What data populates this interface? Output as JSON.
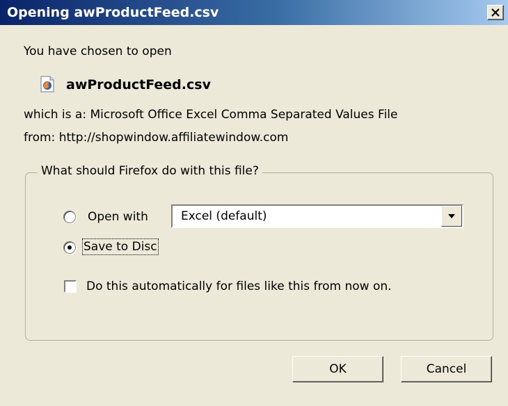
{
  "window": {
    "title": "Opening awProductFeed.csv",
    "close_glyph": "✕"
  },
  "intro": {
    "chosen_text": "You have chosen to open",
    "file_name": "awProductFeed.csv",
    "file_icon": "firefox-document-icon"
  },
  "details": {
    "which_is": "which is a:  Microsoft Office Excel Comma Separated Values File",
    "from": "from:  http://shopwindow.affiliatewindow.com"
  },
  "group": {
    "legend": "What should Firefox do with this file?",
    "open_with": {
      "label": "Open with",
      "selected": false,
      "app_value": "Excel (default)"
    },
    "save_to_disc": {
      "label": "Save to Disc",
      "selected": true
    },
    "auto_checkbox": {
      "label": "Do this automatically for files like this from now on.",
      "checked": false
    }
  },
  "buttons": {
    "ok": "OK",
    "cancel": "Cancel"
  },
  "colors": {
    "titlebar_start": "#0a246a",
    "titlebar_end": "#a6caf0",
    "dialog_bg": "#ece9d8"
  }
}
